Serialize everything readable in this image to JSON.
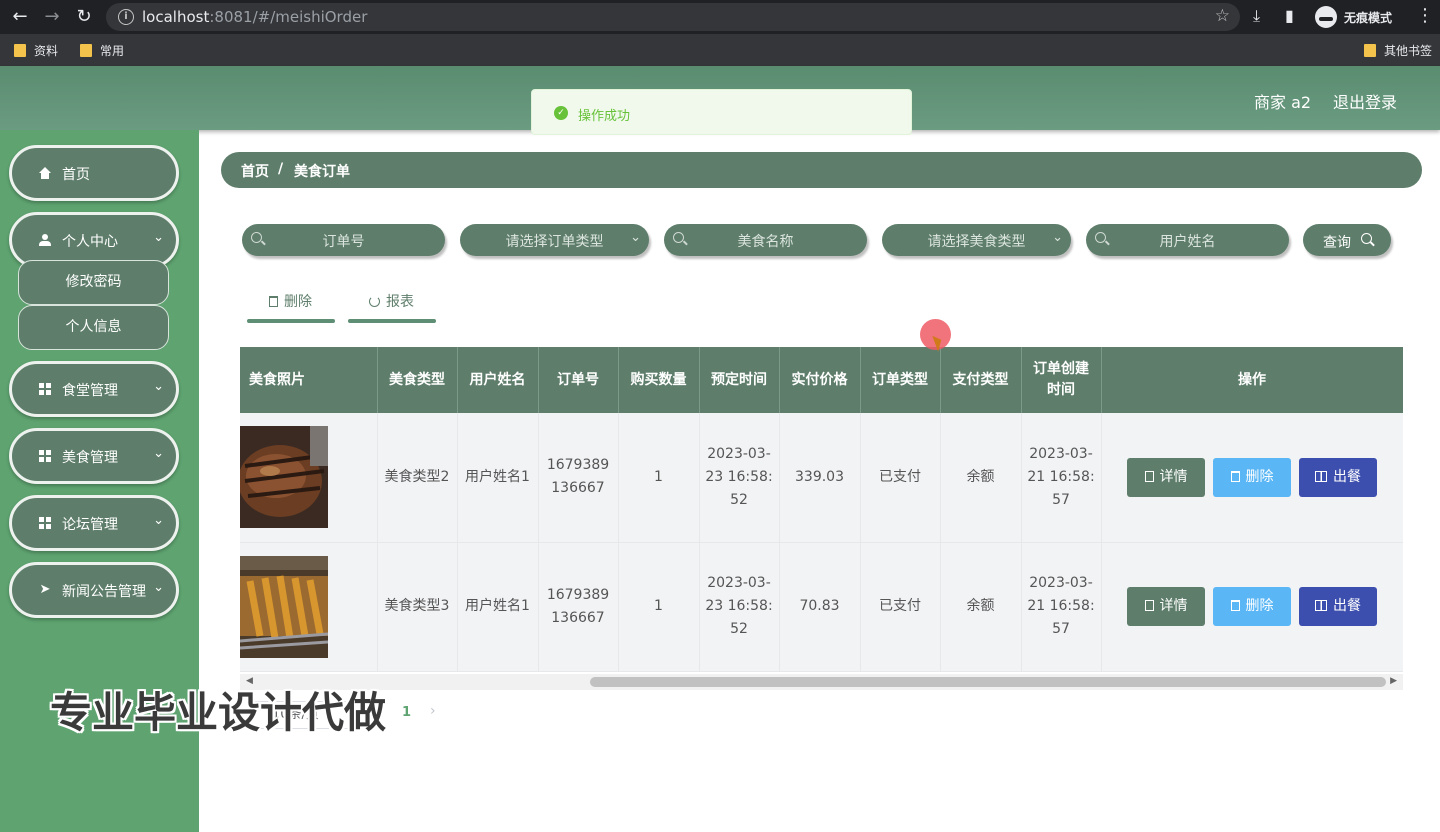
{
  "browser": {
    "url_host": "localhost",
    "url_rest": ":8081/#/meishiOrder",
    "incognito_label": "无痕模式",
    "bookmarks": [
      "资料",
      "常用"
    ],
    "other_bookmarks": "其他书签"
  },
  "header": {
    "merchant": "商家 a2",
    "logout": "退出登录"
  },
  "toast": {
    "message": "操作成功",
    "type": "success"
  },
  "sidebar": {
    "items": [
      {
        "label": "首页",
        "icon": "home-icon"
      },
      {
        "label": "个人中心",
        "icon": "user-icon"
      },
      {
        "label": "食堂管理",
        "icon": "grid-icon"
      },
      {
        "label": "美食管理",
        "icon": "grid-icon"
      },
      {
        "label": "论坛管理",
        "icon": "grid-icon"
      },
      {
        "label": "新闻公告管理",
        "icon": "send-icon"
      }
    ],
    "submenu": [
      "修改密码",
      "个人信息"
    ]
  },
  "breadcrumb": {
    "home": "首页",
    "separator": "/",
    "current": "美食订单"
  },
  "search": {
    "order_no": "订单号",
    "order_type": "请选择订单类型",
    "food_name": "美食名称",
    "food_type": "请选择美食类型",
    "user_name": "用户姓名",
    "query_button": "查询"
  },
  "actions": {
    "delete": "删除",
    "report": "报表"
  },
  "table": {
    "columns": [
      "美食照片",
      "美食类型",
      "用户姓名",
      "订单号",
      "购买数量",
      "预定时间",
      "实付价格",
      "订单类型",
      "支付类型",
      "订单创建时间",
      "操作"
    ],
    "rows": [
      {
        "food_type": "美食类型2",
        "user_name": "用户姓名1",
        "order_no": "1679389136667",
        "quantity": "1",
        "booking_time": "2023-03-23 16:58:52",
        "price": "339.03",
        "order_type": "已支付",
        "pay_type": "余额",
        "created_time": "2023-03-21 16:58:57"
      },
      {
        "food_type": "美食类型3",
        "user_name": "用户姓名1",
        "order_no": "1679389136667",
        "quantity": "1",
        "booking_time": "2023-03-23 16:58:52",
        "price": "70.83",
        "order_type": "已支付",
        "pay_type": "余额",
        "created_time": "2023-03-21 16:58:57"
      }
    ],
    "op_detail": "详情",
    "op_delete": "删除",
    "op_serve": "出餐"
  },
  "pagination": {
    "page_size": "10条/页",
    "current_page": "1"
  },
  "watermark": "专业毕业设计代做",
  "colors": {
    "sidebar_bg": "#5ea370",
    "primary": "#5e7e6b",
    "delete_btn": "#5ab6f4",
    "serve_btn": "#3d4fae",
    "toast_text": "#67c23a"
  }
}
